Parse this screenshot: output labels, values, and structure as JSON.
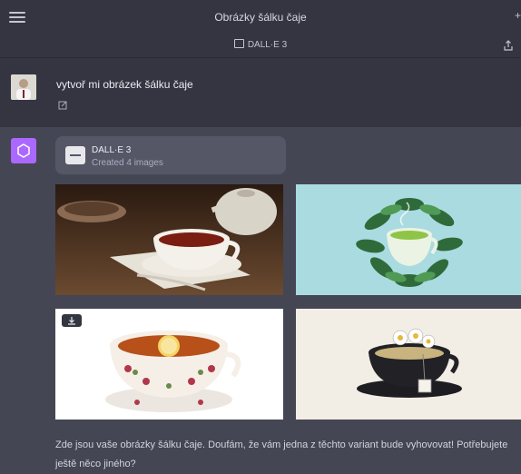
{
  "header": {
    "title": "Obrázky šálku čaje",
    "model_label": "DALL·E 3",
    "menu_icon": "hamburger-menu-icon",
    "share_icon": "share-icon"
  },
  "user_message": {
    "text": "vytvoř mi obrázek šálku čaje",
    "edit_icon": "edit-icon"
  },
  "assistant": {
    "avatar_color": "#ab68ff",
    "tool": {
      "name": "DALL·E 3",
      "status": "Created 4 images"
    },
    "images": [
      {
        "subject": "tea cup on wooden table with teapot"
      },
      {
        "subject": "green tea cup with leaves, teal background"
      },
      {
        "subject": "floral porcelain cup with lemon slice"
      },
      {
        "subject": "black cup with daisies and tea bag"
      }
    ],
    "download_icon": "download-icon",
    "reply_text": "Zde jsou vaše obrázky šálku čaje. Doufám, že vám jedna z těchto variant bude vyhovovat! Potřebujete ještě něco jiného?"
  },
  "colors": {
    "background": "#444654",
    "bar": "#343541",
    "card": "#555767",
    "text": "#ececf1"
  }
}
